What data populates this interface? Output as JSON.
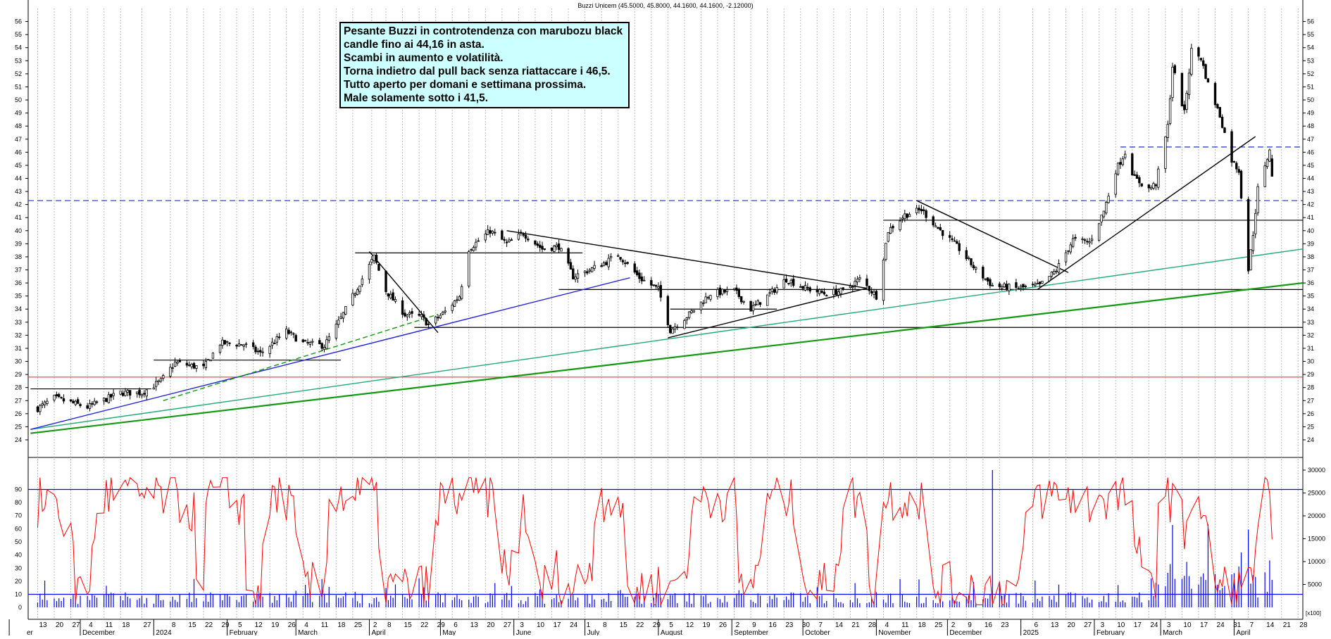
{
  "header": {
    "title": "Buzzi Unicem (45.5000, 45.8000, 44.1600, 44.1600, -2.12000)"
  },
  "annotation": {
    "lines": [
      "Pesante Buzzi in controtendenza con marubozu black",
      "candle fino ai 44,16 in asta.",
      "Scambi in aumento e volatilità.",
      "Torna indietro dal pull back senza riattaccare i 46,5.",
      "Tutto aperto per domani e settimana prossima.",
      "Male solamente sotto i 41,5."
    ]
  },
  "colors": {
    "price": "#000000",
    "oscillator": "#ff0000",
    "volume": "#0000ff",
    "support_dashed": "#2233bb",
    "resistance_red": "#ff3333",
    "trend_green": "#119911",
    "trend_teal": "#22aa77",
    "trend_blue": "#2222dd",
    "note_bg": "#ccffff"
  },
  "chart_data": [
    {
      "type": "candlestick",
      "title": "Buzzi Unicem (45.5000, 45.8000, 44.1600, 44.1600, -2.12000)",
      "ylim": [
        23.3,
        57
      ],
      "y_ticks": [
        24,
        25,
        26,
        27,
        28,
        29,
        30,
        31,
        32,
        33,
        34,
        35,
        36,
        37,
        38,
        39,
        40,
        41,
        42,
        43,
        44,
        45,
        46,
        47,
        48,
        49,
        50,
        51,
        52,
        53,
        54,
        55,
        56
      ],
      "x_range": [
        "2023-11-13",
        "2025-04-30"
      ],
      "grid": true,
      "last_bar": {
        "open": 45.5,
        "high": 45.8,
        "low": 44.16,
        "close": 44.16,
        "change": -2.12
      },
      "anchors": [
        {
          "date": "2023-11-13",
          "close": 26.4
        },
        {
          "date": "2023-11-20",
          "close": 27.2
        },
        {
          "date": "2023-12-04",
          "close": 26.5
        },
        {
          "date": "2023-12-18",
          "close": 27.6
        },
        {
          "date": "2023-12-27",
          "close": 27.6
        },
        {
          "date": "2024-01-04",
          "close": 28.5
        },
        {
          "date": "2024-01-10",
          "close": 29.9
        },
        {
          "date": "2024-01-22",
          "close": 29.5
        },
        {
          "date": "2024-01-29",
          "close": 31.4
        },
        {
          "date": "2024-02-08",
          "close": 31.3
        },
        {
          "date": "2024-02-15",
          "close": 30.6
        },
        {
          "date": "2024-02-26",
          "close": 32.3
        },
        {
          "date": "2024-03-04",
          "close": 31.4
        },
        {
          "date": "2024-03-13",
          "close": 31.2
        },
        {
          "date": "2024-03-20",
          "close": 33.3
        },
        {
          "date": "2024-03-28",
          "close": 36.0
        },
        {
          "date": "2024-04-03",
          "close": 38.0
        },
        {
          "date": "2024-04-08",
          "close": 35.4
        },
        {
          "date": "2024-04-16",
          "close": 33.6
        },
        {
          "date": "2024-04-23",
          "close": 33.4
        },
        {
          "date": "2024-04-26",
          "close": 32.8
        },
        {
          "date": "2024-05-03",
          "close": 33.8
        },
        {
          "date": "2024-05-09",
          "close": 35.0
        },
        {
          "date": "2024-05-13",
          "close": 38.6
        },
        {
          "date": "2024-05-22",
          "close": 40.0
        },
        {
          "date": "2024-05-29",
          "close": 39.0
        },
        {
          "date": "2024-06-05",
          "close": 39.8
        },
        {
          "date": "2024-06-13",
          "close": 38.6
        },
        {
          "date": "2024-06-20",
          "close": 38.8
        },
        {
          "date": "2024-06-26",
          "close": 36.5
        },
        {
          "date": "2024-07-03",
          "close": 37.0
        },
        {
          "date": "2024-07-10",
          "close": 37.6
        },
        {
          "date": "2024-07-15",
          "close": 38.2
        },
        {
          "date": "2024-07-24",
          "close": 36.4
        },
        {
          "date": "2024-08-01",
          "close": 35.5
        },
        {
          "date": "2024-08-06",
          "close": 32.4
        },
        {
          "date": "2024-08-14",
          "close": 33.6
        },
        {
          "date": "2024-08-23",
          "close": 35.2
        },
        {
          "date": "2024-09-02",
          "close": 35.4
        },
        {
          "date": "2024-09-09",
          "close": 34.0
        },
        {
          "date": "2024-09-16",
          "close": 35.0
        },
        {
          "date": "2024-09-24",
          "close": 36.3
        },
        {
          "date": "2024-10-02",
          "close": 35.6
        },
        {
          "date": "2024-10-10",
          "close": 35.2
        },
        {
          "date": "2024-10-18",
          "close": 35.4
        },
        {
          "date": "2024-10-25",
          "close": 36.3
        },
        {
          "date": "2024-11-01",
          "close": 35.0
        },
        {
          "date": "2024-11-06",
          "close": 40.0
        },
        {
          "date": "2024-11-13",
          "close": 41.2
        },
        {
          "date": "2024-11-20",
          "close": 41.6
        },
        {
          "date": "2024-11-27",
          "close": 40.2
        },
        {
          "date": "2024-12-06",
          "close": 38.6
        },
        {
          "date": "2024-12-13",
          "close": 37.0
        },
        {
          "date": "2024-12-20",
          "close": 35.8
        },
        {
          "date": "2024-12-30",
          "close": 35.6
        },
        {
          "date": "2025-01-09",
          "close": 35.8
        },
        {
          "date": "2025-01-16",
          "close": 37.0
        },
        {
          "date": "2025-01-23",
          "close": 39.3
        },
        {
          "date": "2025-01-30",
          "close": 39.1
        },
        {
          "date": "2025-02-05",
          "close": 41.5
        },
        {
          "date": "2025-02-10",
          "close": 44.6
        },
        {
          "date": "2025-02-14",
          "close": 46.0
        },
        {
          "date": "2025-02-18",
          "close": 44.0
        },
        {
          "date": "2025-02-24",
          "close": 43.2
        },
        {
          "date": "2025-02-27",
          "close": 43.6
        },
        {
          "date": "2025-03-04",
          "close": 48.0
        },
        {
          "date": "2025-03-06",
          "close": 52.6
        },
        {
          "date": "2025-03-11",
          "close": 49.0
        },
        {
          "date": "2025-03-14",
          "close": 53.8
        },
        {
          "date": "2025-03-18",
          "close": 53.2
        },
        {
          "date": "2025-03-21",
          "close": 51.2
        },
        {
          "date": "2025-03-26",
          "close": 48.8
        },
        {
          "date": "2025-03-31",
          "close": 45.4
        },
        {
          "date": "2025-04-03",
          "close": 44.6
        },
        {
          "date": "2025-04-07",
          "close": 37.0
        },
        {
          "date": "2025-04-09",
          "close": 39.8
        },
        {
          "date": "2025-04-11",
          "close": 43.2
        },
        {
          "date": "2025-04-14",
          "close": 44.8
        },
        {
          "date": "2025-04-16",
          "close": 46.28
        },
        {
          "date": "2025-04-17",
          "close": 44.16
        }
      ],
      "horizontal_lines": [
        {
          "y": 42.3,
          "style": "dashed",
          "color": "#2233bb"
        },
        {
          "y": 46.4,
          "style": "dashed",
          "color": "#2233bb",
          "from": "2025-02-12"
        },
        {
          "y": 28.8,
          "color": "#ff3333"
        },
        {
          "y": 32.6,
          "color": "#000000",
          "from": "2024-04-20"
        },
        {
          "y": 35.5,
          "color": "#000000",
          "from": "2024-06-20"
        },
        {
          "y": 40.8,
          "color": "#000000",
          "from": "2024-11-04"
        },
        {
          "y": 38.3,
          "color": "#000000",
          "from": "2024-03-26",
          "to": "2024-06-30"
        },
        {
          "y": 30.1,
          "color": "#000000",
          "from": "2024-01-01",
          "to": "2024-03-20"
        },
        {
          "y": 27.9,
          "color": "#000000",
          "from": "2023-11-10",
          "to": "2023-12-31"
        },
        {
          "y": 34.0,
          "color": "#000000",
          "from": "2024-08-06",
          "to": "2024-09-20"
        }
      ],
      "trend_lines": [
        {
          "from": [
            "2023-11-10",
            24.5
          ],
          "to": [
            "2025-04-30",
            36.0
          ],
          "color": "#119911"
        },
        {
          "from": [
            "2023-11-10",
            24.8
          ],
          "to": [
            "2025-04-30",
            38.6
          ],
          "color": "#22aa77"
        },
        {
          "from": [
            "2023-11-10",
            24.8
          ],
          "to": [
            "2024-07-20",
            36.4
          ],
          "color": "#2222dd"
        },
        {
          "from": [
            "2024-01-05",
            27.0
          ],
          "to": [
            "2024-04-30",
            33.6
          ],
          "color": "#119911",
          "style": "dashed"
        },
        {
          "from": [
            "2024-05-29",
            40.0
          ],
          "to": [
            "2024-10-28",
            35.6
          ],
          "color": "#000000"
        },
        {
          "from": [
            "2024-04-01",
            38.4
          ],
          "to": [
            "2024-04-30",
            32.2
          ],
          "color": "#000000"
        },
        {
          "from": [
            "2024-11-18",
            42.3
          ],
          "to": [
            "2025-01-21",
            36.8
          ],
          "color": "#000000"
        },
        {
          "from": [
            "2024-08-05",
            31.8
          ],
          "to": [
            "2024-10-28",
            35.6
          ],
          "color": "#000000"
        },
        {
          "from": [
            "2025-01-08",
            35.5
          ],
          "to": [
            "2025-04-10",
            47.2
          ],
          "color": "#000000"
        }
      ]
    },
    {
      "type": "line",
      "name": "oscillator",
      "ylim": [
        -1,
        101
      ],
      "y_ticks": [
        0,
        10,
        20,
        30,
        40,
        50,
        60,
        70,
        80,
        90
      ],
      "reference_lines": [
        90,
        10
      ],
      "last_value": 52
    },
    {
      "type": "bar",
      "name": "volume",
      "ylim": [
        0,
        30000
      ],
      "y_ticks": [
        5000,
        10000,
        15000,
        20000,
        25000,
        30000
      ],
      "notable": [
        {
          "date": "2024-12-20",
          "value": 30000
        },
        {
          "date": "2025-03-06",
          "value": 18000
        },
        {
          "date": "2025-04-07",
          "value": 17000
        },
        {
          "date": "2025-04-04",
          "value": 12000
        },
        {
          "date": "2025-04-17",
          "value": 6000
        }
      ]
    }
  ],
  "x_axis": {
    "day_ticks": [
      {
        "d": "2023-11-13",
        "t": "13"
      },
      {
        "d": "2023-11-20",
        "t": "20"
      },
      {
        "d": "2023-11-27",
        "t": "27"
      },
      {
        "d": "2023-12-04",
        "t": "4"
      },
      {
        "d": "2023-12-11",
        "t": "11"
      },
      {
        "d": "2023-12-18",
        "t": "18"
      },
      {
        "d": "2023-12-27",
        "t": "27"
      },
      {
        "d": "2024-01-08",
        "t": "8"
      },
      {
        "d": "2024-01-15",
        "t": "15"
      },
      {
        "d": "2024-01-22",
        "t": "22"
      },
      {
        "d": "2024-01-29",
        "t": "29"
      },
      {
        "d": "2024-02-05",
        "t": "5"
      },
      {
        "d": "2024-02-12",
        "t": "12"
      },
      {
        "d": "2024-02-19",
        "t": "19"
      },
      {
        "d": "2024-02-26",
        "t": "26"
      },
      {
        "d": "2024-03-04",
        "t": "4"
      },
      {
        "d": "2024-03-11",
        "t": "11"
      },
      {
        "d": "2024-03-18",
        "t": "18"
      },
      {
        "d": "2024-03-25",
        "t": "25"
      },
      {
        "d": "2024-04-02",
        "t": "2"
      },
      {
        "d": "2024-04-08",
        "t": "8"
      },
      {
        "d": "2024-04-15",
        "t": "15"
      },
      {
        "d": "2024-04-22",
        "t": "22"
      },
      {
        "d": "2024-04-29",
        "t": "29"
      },
      {
        "d": "2024-05-06",
        "t": "6"
      },
      {
        "d": "2024-05-13",
        "t": "13"
      },
      {
        "d": "2024-05-20",
        "t": "20"
      },
      {
        "d": "2024-05-27",
        "t": "27"
      },
      {
        "d": "2024-06-03",
        "t": "3"
      },
      {
        "d": "2024-06-10",
        "t": "10"
      },
      {
        "d": "2024-06-17",
        "t": "17"
      },
      {
        "d": "2024-06-24",
        "t": "24"
      },
      {
        "d": "2024-07-01",
        "t": "1"
      },
      {
        "d": "2024-07-08",
        "t": "8"
      },
      {
        "d": "2024-07-15",
        "t": "15"
      },
      {
        "d": "2024-07-22",
        "t": "22"
      },
      {
        "d": "2024-07-29",
        "t": "29"
      },
      {
        "d": "2024-08-05",
        "t": "5"
      },
      {
        "d": "2024-08-12",
        "t": "12"
      },
      {
        "d": "2024-08-19",
        "t": "19"
      },
      {
        "d": "2024-08-26",
        "t": "26"
      },
      {
        "d": "2024-09-02",
        "t": "2"
      },
      {
        "d": "2024-09-09",
        "t": "9"
      },
      {
        "d": "2024-09-16",
        "t": "16"
      },
      {
        "d": "2024-09-23",
        "t": "23"
      },
      {
        "d": "2024-09-30",
        "t": "30"
      },
      {
        "d": "2024-10-07",
        "t": "7"
      },
      {
        "d": "2024-10-14",
        "t": "14"
      },
      {
        "d": "2024-10-21",
        "t": "21"
      },
      {
        "d": "2024-10-28",
        "t": "28"
      },
      {
        "d": "2024-11-04",
        "t": "4"
      },
      {
        "d": "2024-11-11",
        "t": "11"
      },
      {
        "d": "2024-11-18",
        "t": "18"
      },
      {
        "d": "2024-11-25",
        "t": "25"
      },
      {
        "d": "2024-12-02",
        "t": "2"
      },
      {
        "d": "2024-12-09",
        "t": "9"
      },
      {
        "d": "2024-12-16",
        "t": "16"
      },
      {
        "d": "2024-12-23",
        "t": "23"
      },
      {
        "d": "2025-01-06",
        "t": "6"
      },
      {
        "d": "2025-01-13",
        "t": "13"
      },
      {
        "d": "2025-01-20",
        "t": "20"
      },
      {
        "d": "2025-01-27",
        "t": "27"
      },
      {
        "d": "2025-02-03",
        "t": "3"
      },
      {
        "d": "2025-02-10",
        "t": "10"
      },
      {
        "d": "2025-02-17",
        "t": "17"
      },
      {
        "d": "2025-02-24",
        "t": "24"
      },
      {
        "d": "2025-03-03",
        "t": "3"
      },
      {
        "d": "2025-03-10",
        "t": "10"
      },
      {
        "d": "2025-03-17",
        "t": "17"
      },
      {
        "d": "2025-03-24",
        "t": "24"
      },
      {
        "d": "2025-03-31",
        "t": "31"
      },
      {
        "d": "2025-04-07",
        "t": "7"
      },
      {
        "d": "2025-04-14",
        "t": "14"
      },
      {
        "d": "2025-04-21",
        "t": "21"
      },
      {
        "d": "2025-04-28",
        "t": "28"
      }
    ],
    "month_labels": [
      {
        "d": "2023-11-01",
        "t": "er"
      },
      {
        "d": "2023-12-01",
        "t": "December"
      },
      {
        "d": "2024-01-01",
        "t": "2024"
      },
      {
        "d": "2024-02-01",
        "t": "February"
      },
      {
        "d": "2024-03-01",
        "t": "March"
      },
      {
        "d": "2024-04-01",
        "t": "April"
      },
      {
        "d": "2024-05-01",
        "t": "May"
      },
      {
        "d": "2024-06-01",
        "t": "June"
      },
      {
        "d": "2024-07-01",
        "t": "July"
      },
      {
        "d": "2024-08-01",
        "t": "August"
      },
      {
        "d": "2024-09-01",
        "t": "September"
      },
      {
        "d": "2024-10-01",
        "t": "October"
      },
      {
        "d": "2024-11-01",
        "t": "November"
      },
      {
        "d": "2024-12-01",
        "t": "December"
      },
      {
        "d": "2025-01-01",
        "t": "2025"
      },
      {
        "d": "2025-02-01",
        "t": "February"
      },
      {
        "d": "2025-03-01",
        "t": "March"
      },
      {
        "d": "2025-04-01",
        "t": "April"
      }
    ],
    "scale_badge": "x100"
  }
}
